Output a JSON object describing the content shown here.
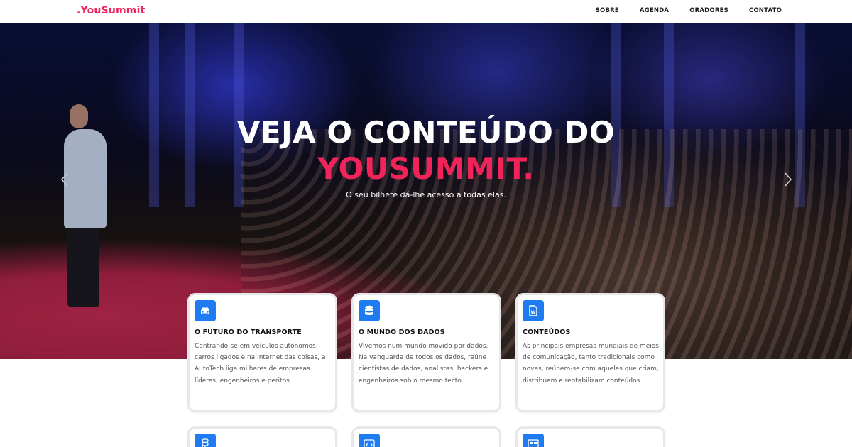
{
  "brand": {
    "name": ".YouSummit",
    "accent": "#f0245a",
    "icon_bg": "#1f7bf2"
  },
  "nav": {
    "items": [
      "SOBRE",
      "AGENDA",
      "ORADORES",
      "CONTATO"
    ]
  },
  "hero": {
    "title_line1": "VEJA O CONTEÚDO DO",
    "title_line2": "YOUSUMMIT.",
    "subtitle": "O seu bilhete dá-lhe acesso a todas elas.",
    "prev_icon": "chevron-left-icon",
    "next_icon": "chevron-right-icon"
  },
  "cards": [
    {
      "icon": "car-icon",
      "title": "O FUTURO DO TRANSPORTE",
      "text": "Centrando-se em veículos autónomos, carros ligados e na Internet das coisas, a AutoTech liga milhares de empresas líderes, engenheiros e peritos."
    },
    {
      "icon": "database-icon",
      "title": "O MUNDO DOS DADOS",
      "text": "Vivemos num mundo movido por dados. Na vanguarda de todos os dados, reúne cientistas de dados, analistas, hackers e engenheiros sob o mesmo tecto."
    },
    {
      "icon": "word-document-icon",
      "title": "CONTEÚDOS",
      "text": "As principais empresas mundiais de meios de comunicação, tanto tradicionais como novas, reúnem-se com aqueles que criam, distribuem e rentabilizam conteúdos."
    },
    {
      "icon": "figma-icon"
    },
    {
      "icon": "code-window-icon"
    },
    {
      "icon": "news-layout-icon"
    }
  ]
}
